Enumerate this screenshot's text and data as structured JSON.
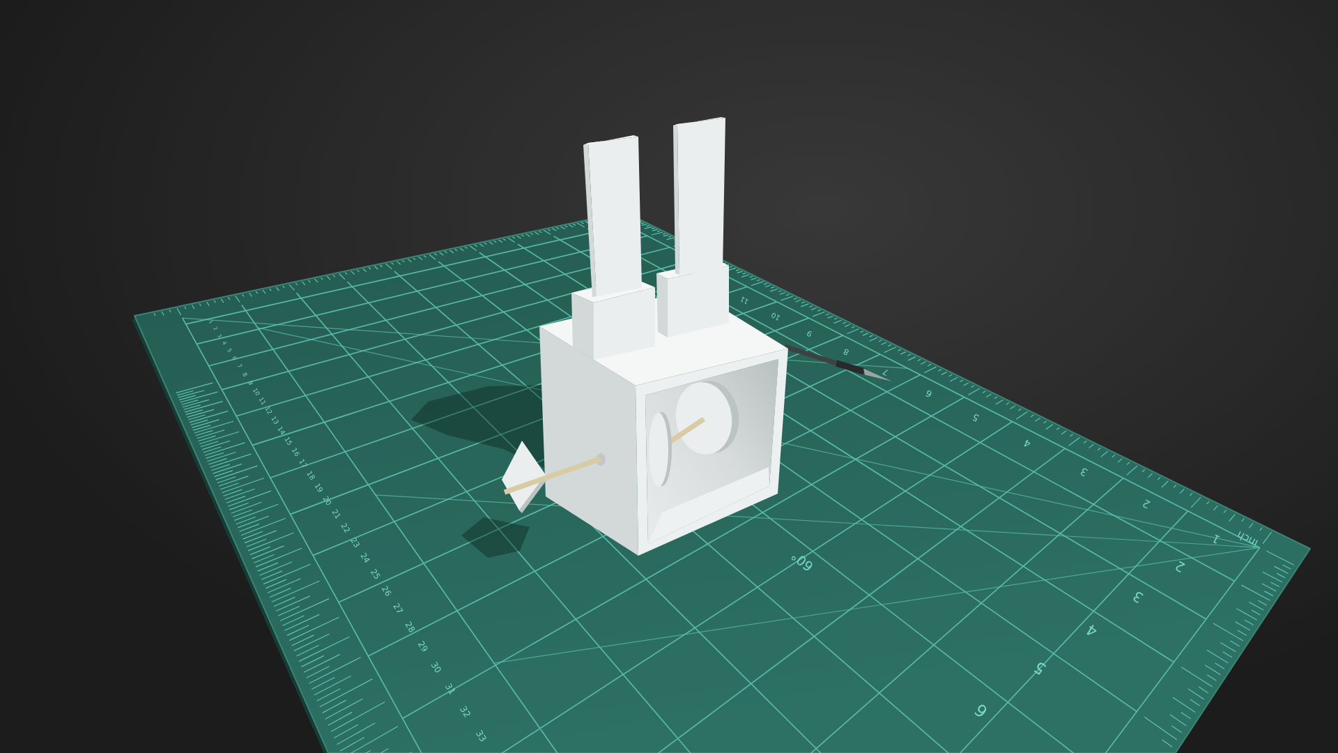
{
  "mat": {
    "left_ruler": [
      "1",
      "2",
      "3",
      "4",
      "5",
      "6",
      "7",
      "8",
      "9",
      "10",
      "11",
      "12",
      "13",
      "14",
      "15",
      "16",
      "17",
      "18",
      "19",
      "20",
      "21",
      "22",
      "23",
      "24",
      "25",
      "26",
      "27",
      "28",
      "29",
      "30",
      "31",
      "32",
      "33"
    ],
    "top_ruler": [
      "1",
      "2",
      "3",
      "4",
      "5",
      "6",
      "7",
      "8",
      "9",
      "10",
      "11"
    ],
    "right_ruler": [
      "2",
      "3",
      "4",
      "5",
      "6"
    ],
    "unit": "inch",
    "angle_label": "60°"
  }
}
